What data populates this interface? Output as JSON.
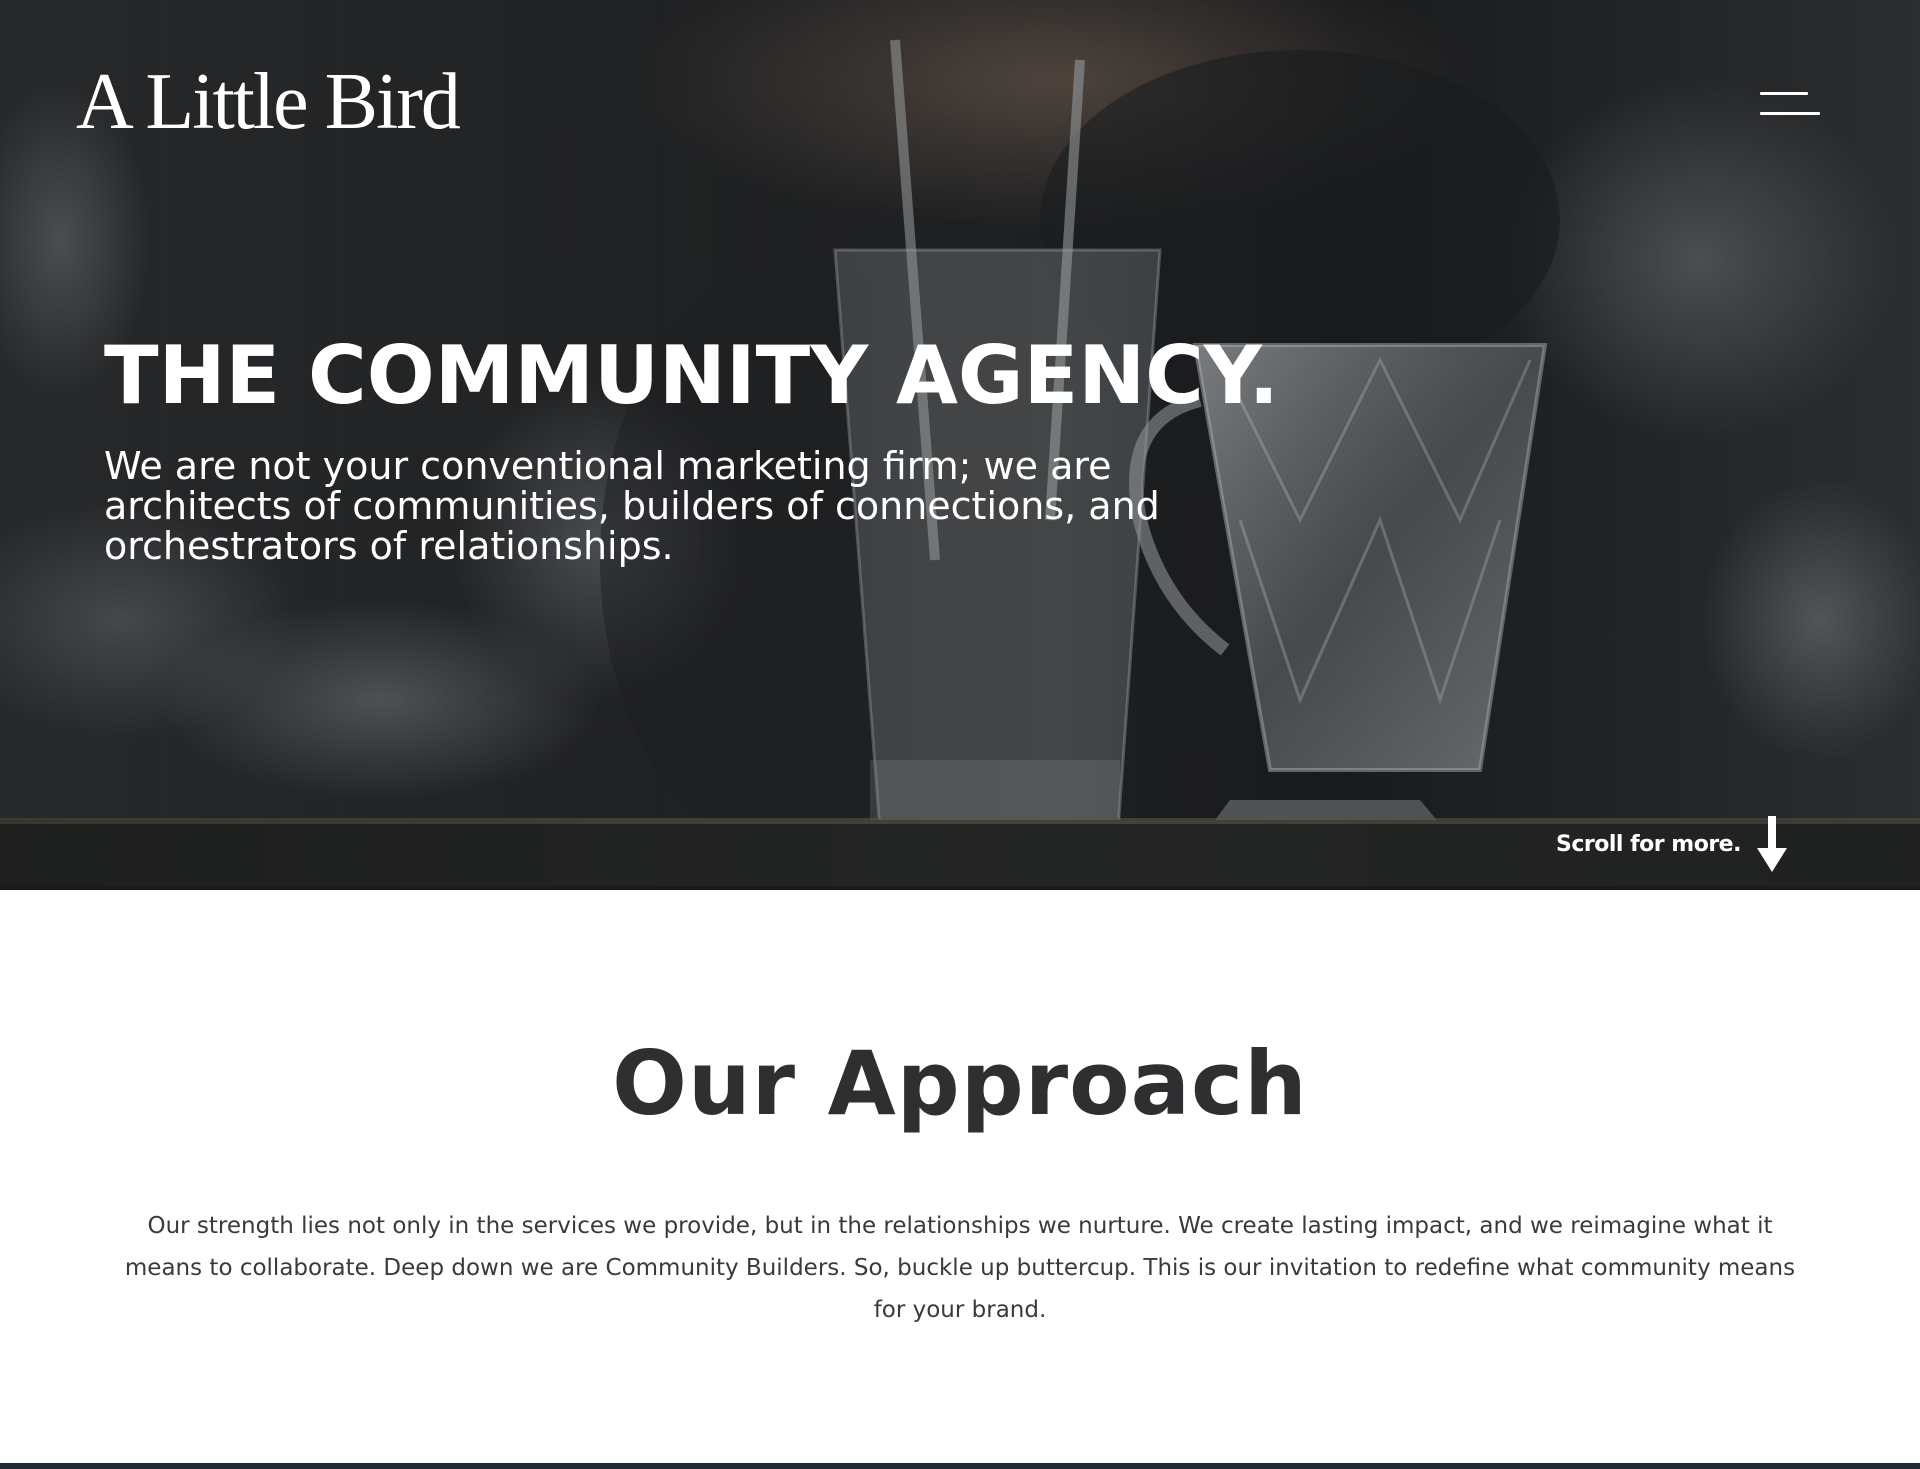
{
  "header": {
    "logo_text": "A Little Bird",
    "menu_icon": "hamburger-menu-icon"
  },
  "hero": {
    "title": "THE COMMUNITY AGENCY.",
    "subtitle": "We are not your conventional marketing firm; we are architects of communities, builders of connections, and orchestrators of relationships.",
    "scroll_label": "Scroll for more.",
    "scroll_icon": "arrow-down-icon"
  },
  "approach": {
    "title": "Our Approach",
    "body": "Our strength lies not only in the services we provide, but in the relationships we nurture. We create lasting impact, and we reimagine what it means to collaborate. Deep down we are Community Builders. So, buckle up buttercup. This is our invitation to redefine what community means for your brand."
  },
  "colors": {
    "hero_text": "#ffffff",
    "heading_dark": "#2f2f31",
    "body_text": "#3a3a3c",
    "page_background": "#ffffff"
  }
}
